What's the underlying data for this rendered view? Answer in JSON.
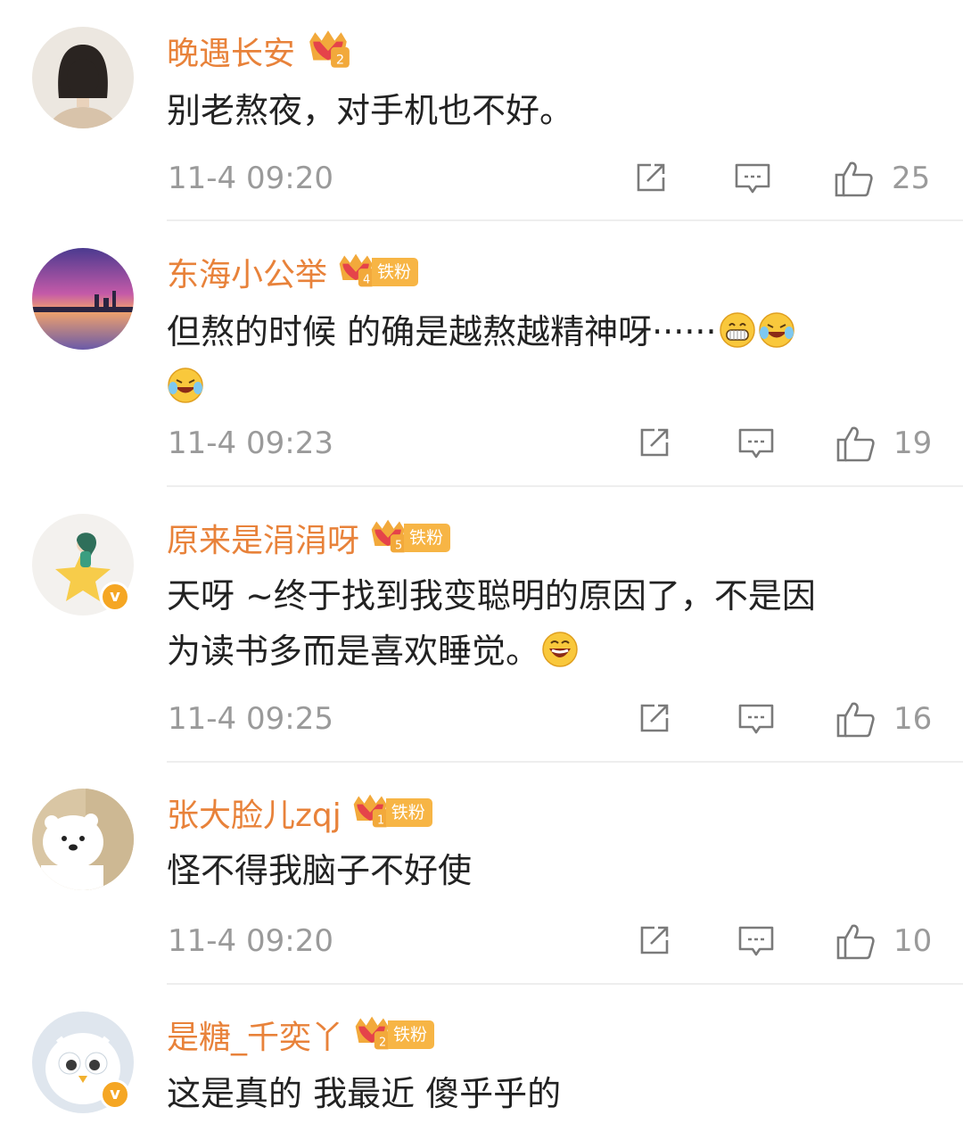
{
  "comments": [
    {
      "name": "晚遇长安",
      "crown_level": "2",
      "fan_badge": "",
      "text_lines": [
        "别老熬夜，对手机也不好。"
      ],
      "time": "11-4 09:20",
      "likes": "25",
      "verified": false,
      "avatar": "girl-bob-hair-avatar"
    },
    {
      "name": "东海小公举",
      "crown_level": "4",
      "fan_badge": "铁粉",
      "text_lines": [
        "但熬的时候 的确是越熬越精神呀······"
      ],
      "time": "11-4 09:23",
      "likes": "19",
      "verified": false,
      "avatar": "sunset-city-avatar"
    },
    {
      "name": "原来是涓涓呀",
      "crown_level": "5",
      "fan_badge": "铁粉",
      "text_lines": [
        "天呀 ~终于找到我变聪明的原因了，不是因",
        "为读书多而是喜欢睡觉。"
      ],
      "time": "11-4 09:25",
      "likes": "16",
      "verified": true,
      "avatar": "star-girl-avatar"
    },
    {
      "name": "张大脸儿zqj",
      "crown_level": "1",
      "fan_badge": "铁粉",
      "text_lines": [
        "怪不得我脑子不好使"
      ],
      "time": "11-4 09:20",
      "likes": "10",
      "verified": false,
      "avatar": "polar-bear-avatar"
    },
    {
      "name": "是糖_千奕丫",
      "crown_level": "2",
      "fan_badge": "铁粉",
      "text_lines": [
        "这是真的 我最近 傻乎乎的"
      ],
      "time": "",
      "likes": "",
      "verified": true,
      "avatar": "white-bird-avatar"
    }
  ],
  "icons": {
    "repost": "share-icon",
    "reply": "comment-icon",
    "like": "thumbs-up-icon",
    "emoji_grin": "grin-emoji-icon",
    "emoji_laugh": "laugh-cry-emoji-icon",
    "emoji_haha": "haha-emoji-icon"
  },
  "colors": {
    "name": "#e8823a",
    "text": "#222222",
    "meta": "#9a9a9a",
    "badge": "#f7b545",
    "verified": "#f5a623"
  }
}
